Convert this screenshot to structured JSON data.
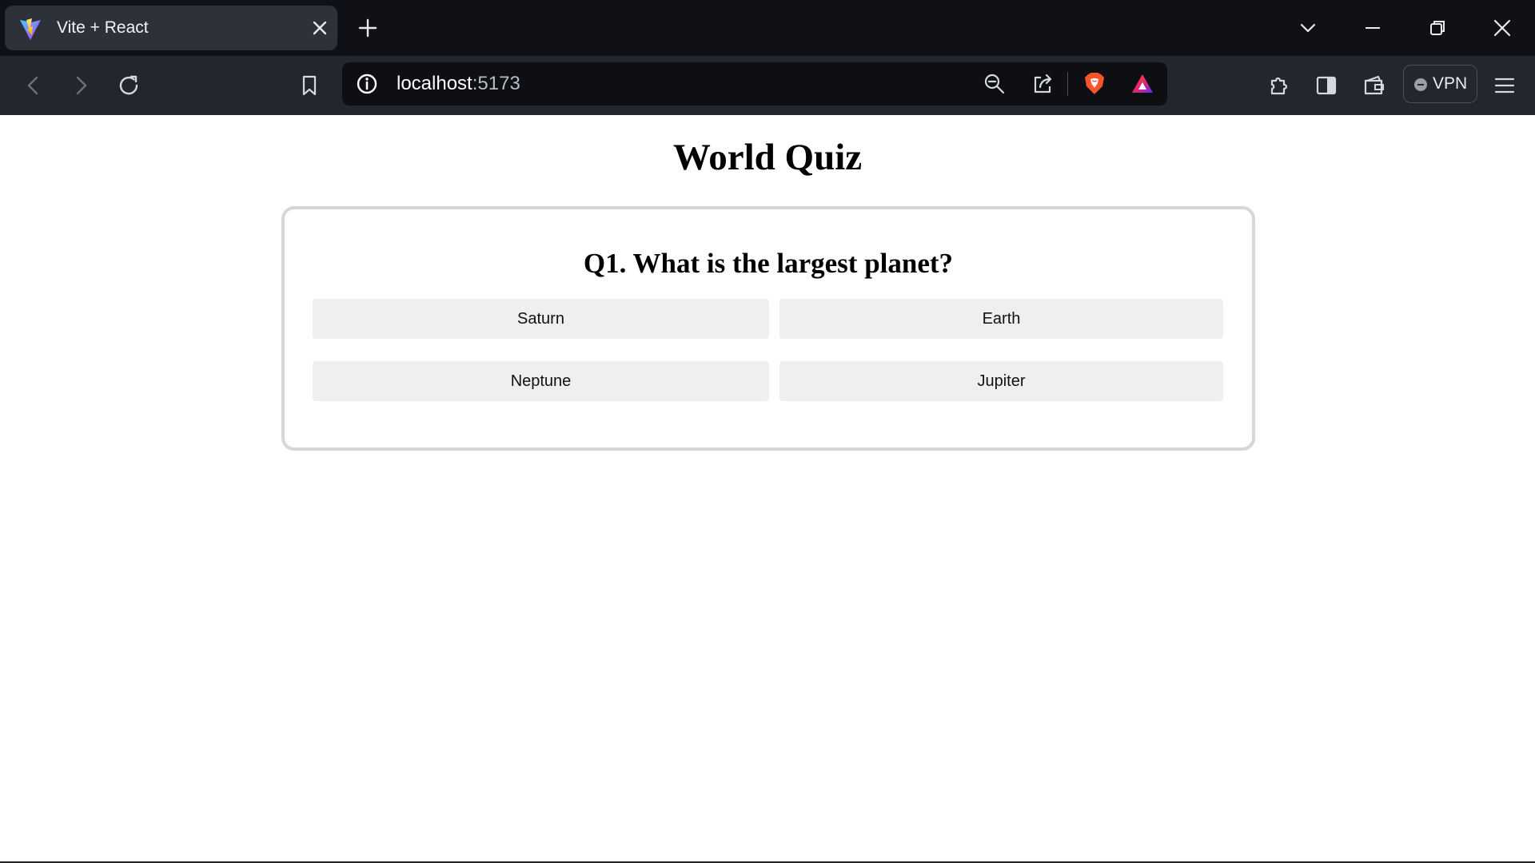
{
  "browser": {
    "tab": {
      "title": "Vite + React",
      "favicon": "vite-logo-icon"
    },
    "url": {
      "host": "localhost",
      "port": ":5173"
    },
    "vpn_label": "VPN",
    "colors": {
      "chrome_dark": "#0f1116",
      "toolbar": "#22262d",
      "brave_orange": "#fb542b"
    }
  },
  "page": {
    "title": "World Quiz",
    "question": "Q1. What is the largest planet?",
    "options": [
      "Saturn",
      "Earth",
      "Neptune",
      "Jupiter"
    ],
    "colors": {
      "option_bg": "#efefef",
      "card_border": "#d6d6d6"
    }
  }
}
